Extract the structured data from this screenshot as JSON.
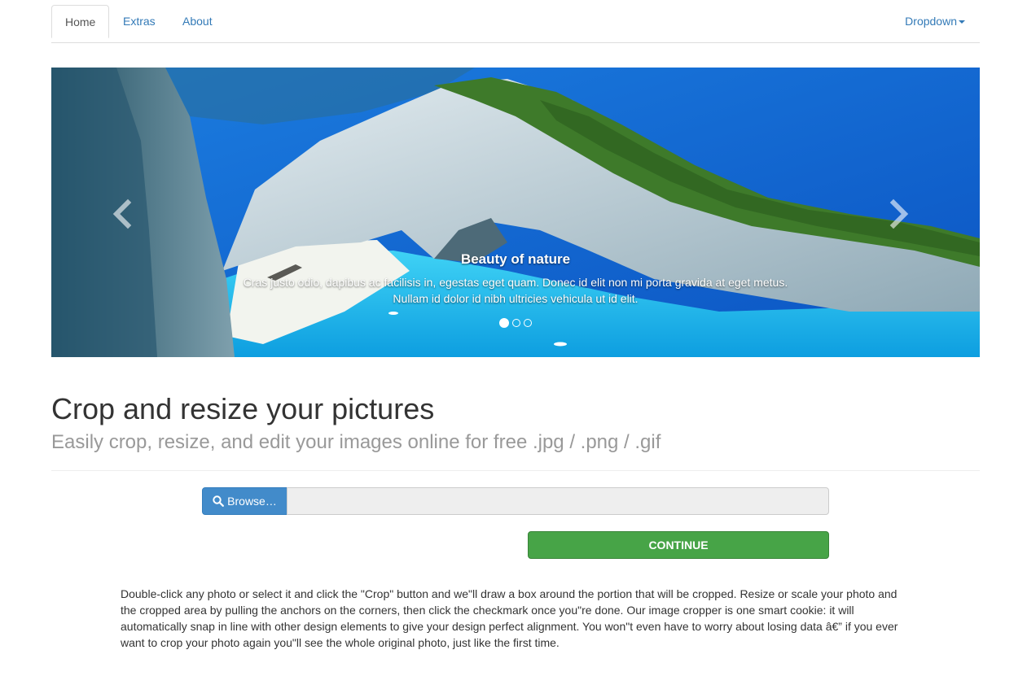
{
  "nav": {
    "tabs": [
      {
        "label": "Home",
        "active": true
      },
      {
        "label": "Extras",
        "active": false
      },
      {
        "label": "About",
        "active": false
      }
    ],
    "dropdown_label": "Dropdown"
  },
  "carousel": {
    "caption_title": "Beauty of nature",
    "caption_text_line1": "Cras justo odio, dapibus ac facilisis in, egestas eget quam. Donec id elit non mi porta gravida at eget metus.",
    "caption_text_line2": "Nullam id dolor id nibh ultricies vehicula ut id elit.",
    "indicators": 3,
    "active_indicator": 0
  },
  "header": {
    "title": "Crop and resize your pictures",
    "subtitle": "Easily crop, resize, and edit your images online for free .jpg / .png / .gif"
  },
  "upload": {
    "browse_label": "Browse…",
    "file_value": "",
    "continue_label": "CONTINUE"
  },
  "description": "Double-click any photo or select it and click the \"Crop\" button and we\"ll draw a box around the portion that will be cropped. Resize or scale your photo and the cropped area by pulling the anchors on the corners, then click the checkmark once you\"re done. Our image cropper is one smart cookie: it will automatically snap in line with other design elements to give your design perfect alignment. You won\"t even have to worry about losing data â€” if you ever want to crop your photo again you\"ll see the whole original photo, just like the first time.",
  "colors": {
    "link": "#337ab7",
    "primary": "#428bca",
    "success": "#47a447",
    "muted": "#999999"
  },
  "icons": {
    "browse": "search-icon",
    "prev": "chevron-left-icon",
    "next": "chevron-right-icon"
  }
}
